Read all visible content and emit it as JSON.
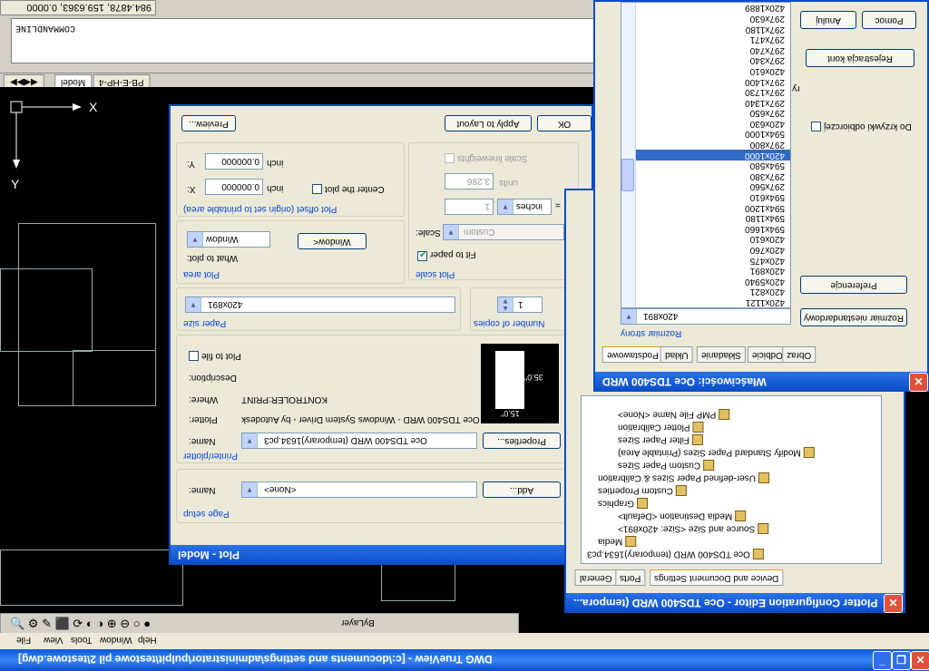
{
  "app": {
    "title": "DWG TrueView - [c:\\documents and settings\\administrator\\pulpit\\testowe pil 2\\testowe.dwg]",
    "menus": [
      "File",
      "View",
      "Tools",
      "Window",
      "Help"
    ],
    "coords": "984.4878, 159.6363, 0.0000",
    "command_label": "COMMANDLINE",
    "layout_tabs": [
      "Model",
      "PB-E-HP-4"
    ],
    "toolbar_label": "ByLayer"
  },
  "plot": {
    "title": "Plot - Model",
    "page_setup": {
      "group": "Page setup",
      "name_label": "Name:",
      "name_value": "<None>",
      "add_label": "Add..."
    },
    "printer": {
      "group": "Printer/plotter",
      "name_label": "Name:",
      "name_value": "Oce TDS400 WRD (temporary)1634.pc3",
      "properties_label": "Properties...",
      "plotter_label": "Plotter:",
      "plotter_value": "Oce TDS400 WRD - Windows System Driver - by Autodesk",
      "where_label": "Where:",
      "where_value": "KONTROLER:PRINT",
      "description_label": "Description:",
      "plot_to_file": "Plot to file",
      "preview_width": "15.0\"",
      "preview_height": "35.0\""
    },
    "paper": {
      "group": "Paper size",
      "value": "420x891"
    },
    "copies": {
      "group": "Number of copies",
      "value": "1"
    },
    "area": {
      "group": "Plot area",
      "what_label": "What to plot:",
      "value": "Window",
      "window_button": "Window<"
    },
    "offset": {
      "group": "Plot offset (origin set to printable area)",
      "x_label": "X:",
      "x_value": "0.000000",
      "x_unit": "inch",
      "y_label": "Y:",
      "y_value": "0.000000",
      "y_unit": "inch",
      "center": "Center the plot"
    },
    "scale": {
      "group": "Plot scale",
      "fit": "Fit to paper",
      "scale_label": "Scale:",
      "scale_value": "Custom",
      "v1": "1",
      "unit": "inches",
      "v2": "3.286",
      "v2_unit": "units",
      "lineweights": "Scale lineweights"
    },
    "preview_button": "Preview...",
    "apply_button": "Apply to Layout",
    "ok_button": "OK"
  },
  "pce": {
    "title": "Plotter Configuration Editor - Oce TDS400 WRD (tempora...",
    "tabs": [
      "General",
      "Ports",
      "Device and Document Settings"
    ],
    "tree": [
      "Oce TDS400 WRD (temporary)1634.pc3",
      "Media",
      "Source and Size <Size: 420x891>",
      "Media Destination <Default>",
      "Graphics",
      "Custom Properties",
      "User-defined Paper Sizes & Calibration",
      "Custom Paper Sizes",
      "Modify Standard Paper Sizes (Printable Area)",
      "Filter Paper Sizes",
      "Plotter Calibration",
      "PMP File Name <None>"
    ]
  },
  "wl": {
    "title": "Właściwości: Oce TDS400 WRD",
    "tabs": [
      "Podstawowe",
      "Układ",
      "Składanie",
      "Odbicie",
      "Obraz"
    ],
    "size_group": "Rozmiar strony",
    "size_value": "420x891",
    "custom_size_btn": "Rozmiar niestandardowy",
    "prefs_btn": "Preferencje",
    "register_btn": "Rejestracja kont",
    "cancel_btn": "Anuluj",
    "help_btn": "Pomoc",
    "cut_chk": "Do krzywki odbiorczej",
    "copies_frag": "ry Oce",
    "list_items": [
      "420x1121",
      "420x821",
      "420x5940",
      "420x891",
      "420x475",
      "420x760",
      "420x610",
      "594x1660",
      "594x1180",
      "594x1200",
      "594x610",
      "297x560",
      "297x380",
      "594x580",
      "420x1000",
      "297x800",
      "594x1000",
      "420x630",
      "297x650",
      "297x1340",
      "297x1730",
      "297x1400",
      "420x610",
      "297x340",
      "297x740",
      "297x471",
      "297x1180",
      "297x630",
      "420x1889"
    ],
    "selected": "420x1000"
  }
}
